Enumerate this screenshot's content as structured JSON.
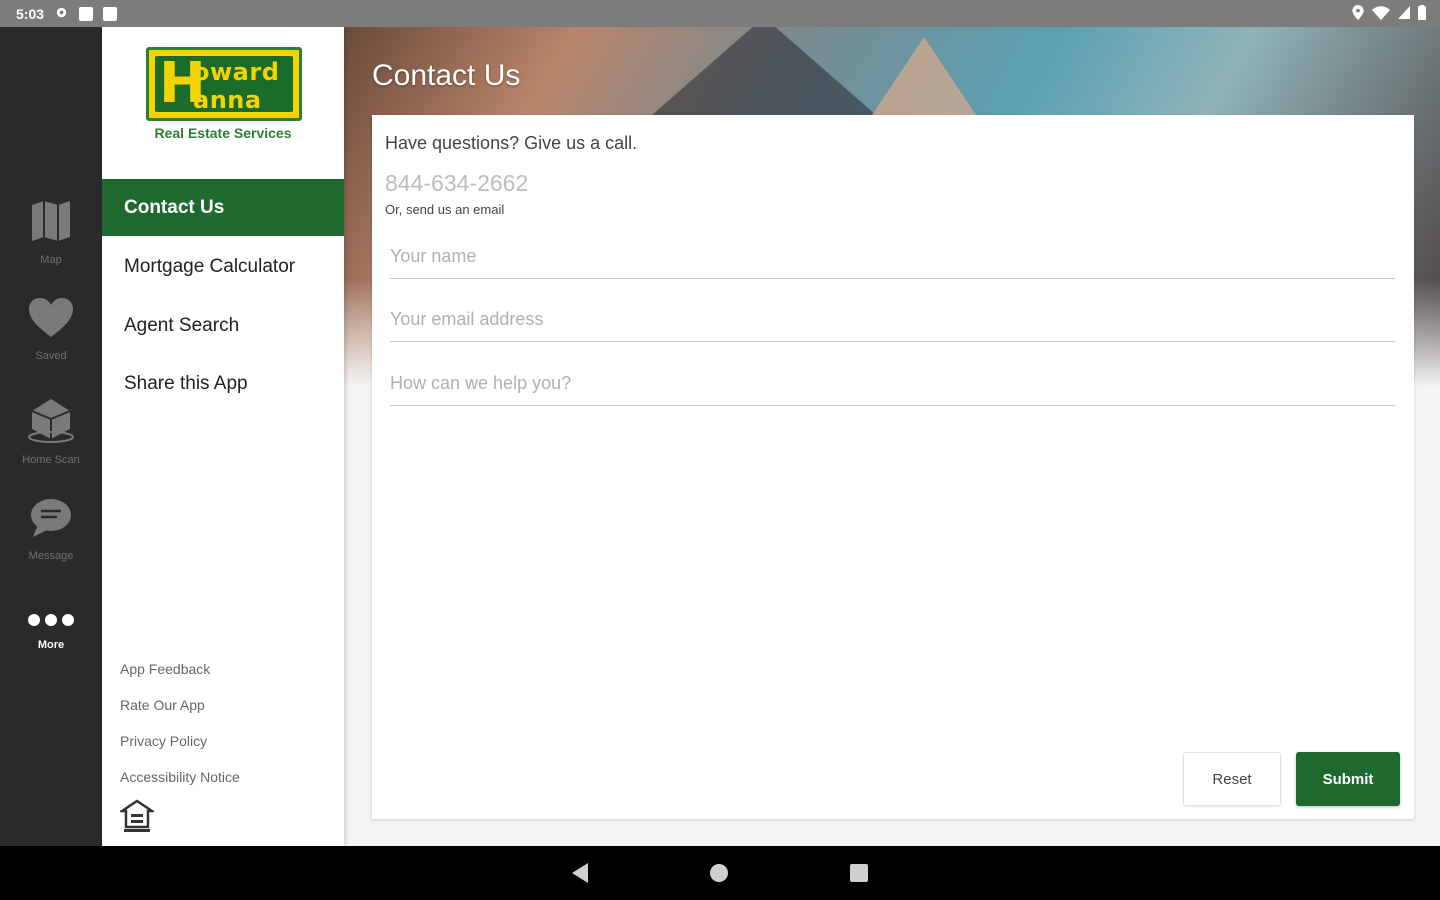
{
  "status_bar": {
    "time": "5:03"
  },
  "rail": {
    "items": [
      {
        "label": "Map",
        "icon": "map-icon"
      },
      {
        "label": "Saved",
        "icon": "heart-icon"
      },
      {
        "label": "Home Scan",
        "icon": "home-scan-icon"
      },
      {
        "label": "Message",
        "icon": "message-icon"
      },
      {
        "label": "More",
        "icon": "more-icon",
        "active": true
      }
    ]
  },
  "drawer": {
    "logo": {
      "line1": "oward",
      "line2": "anna",
      "initial": "H",
      "subtitle": "Real Estate Services"
    },
    "menu": [
      {
        "label": "Contact Us",
        "active": true
      },
      {
        "label": "Mortgage Calculator"
      },
      {
        "label": "Agent Search"
      },
      {
        "label": "Share this App"
      }
    ],
    "footer_links": [
      "App Feedback",
      "Rate Our App",
      "Privacy Policy",
      "Accessibility Notice"
    ]
  },
  "main": {
    "title": "Contact Us",
    "intro": "Have questions? Give us a call.",
    "phone": "844-634-2662",
    "or_email": "Or, send us an email",
    "fields": {
      "name_placeholder": "Your name",
      "email_placeholder": "Your email address",
      "message_placeholder": "How can we help you?"
    },
    "reset_label": "Reset",
    "submit_label": "Submit"
  },
  "colors": {
    "brand_green": "#1e6a2e",
    "brand_yellow": "#f4d300",
    "rail_bg": "#2a2a2a"
  }
}
